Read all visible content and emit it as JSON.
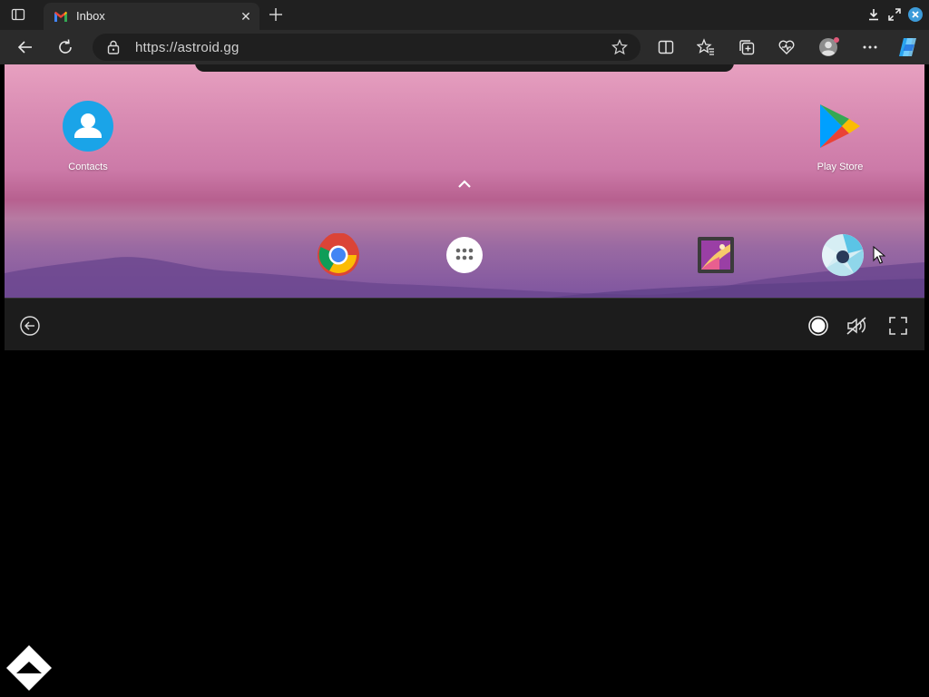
{
  "browser": {
    "tab": {
      "title": "Inbox",
      "favicon": "gmail-icon"
    },
    "new_tab_icon": "plus-icon",
    "address": {
      "url": "https://astroid.gg"
    },
    "toolbar_icons": [
      "back-icon",
      "refresh-icon",
      "lock-icon",
      "star-icon",
      "split-screen-icon",
      "favorites-icon",
      "collections-icon",
      "browser-essentials-icon",
      "profile-icon",
      "more-icon",
      "copilot-icon"
    ],
    "window_controls": [
      "download-icon",
      "restore-icon",
      "close-icon"
    ]
  },
  "android": {
    "home_apps": [
      {
        "label": "Contacts",
        "icon": "contacts-icon"
      },
      {
        "label": "Play Store",
        "icon": "play-store-icon"
      }
    ],
    "dock": [
      {
        "icon": "chrome-icon"
      },
      {
        "icon": "app-drawer-icon"
      },
      {
        "icon": "gallery-icon"
      },
      {
        "icon": "camera-icon"
      }
    ]
  },
  "control_bar": {
    "icons": [
      "back-circle-icon",
      "record-icon",
      "volume-muted-icon",
      "fullscreen-icon"
    ]
  },
  "colors": {
    "tabstrip": "#202020",
    "toolbar": "#2b2b2b",
    "control_bar": "#1c1c1c",
    "wallpaper_top": "#e7a0c0",
    "wallpaper_bottom": "#7e55a0"
  }
}
